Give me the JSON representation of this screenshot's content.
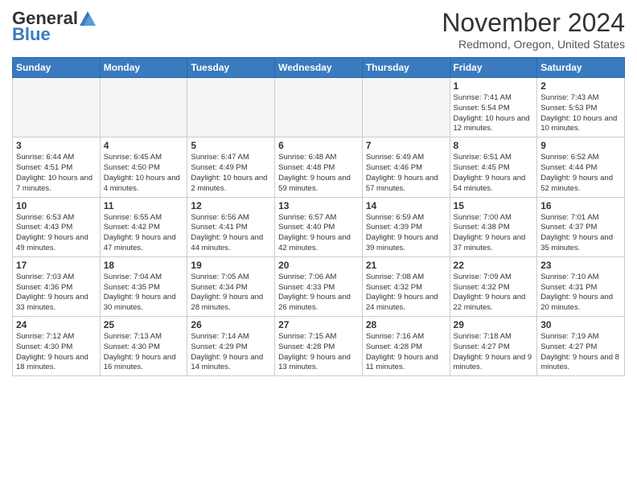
{
  "header": {
    "logo_general": "General",
    "logo_blue": "Blue",
    "month_title": "November 2024",
    "location": "Redmond, Oregon, United States"
  },
  "days_of_week": [
    "Sunday",
    "Monday",
    "Tuesday",
    "Wednesday",
    "Thursday",
    "Friday",
    "Saturday"
  ],
  "weeks": [
    [
      {
        "day": "",
        "info": ""
      },
      {
        "day": "",
        "info": ""
      },
      {
        "day": "",
        "info": ""
      },
      {
        "day": "",
        "info": ""
      },
      {
        "day": "",
        "info": ""
      },
      {
        "day": "1",
        "info": "Sunrise: 7:41 AM\nSunset: 5:54 PM\nDaylight: 10 hours and 12 minutes."
      },
      {
        "day": "2",
        "info": "Sunrise: 7:43 AM\nSunset: 5:53 PM\nDaylight: 10 hours and 10 minutes."
      }
    ],
    [
      {
        "day": "3",
        "info": "Sunrise: 6:44 AM\nSunset: 4:51 PM\nDaylight: 10 hours and 7 minutes."
      },
      {
        "day": "4",
        "info": "Sunrise: 6:45 AM\nSunset: 4:50 PM\nDaylight: 10 hours and 4 minutes."
      },
      {
        "day": "5",
        "info": "Sunrise: 6:47 AM\nSunset: 4:49 PM\nDaylight: 10 hours and 2 minutes."
      },
      {
        "day": "6",
        "info": "Sunrise: 6:48 AM\nSunset: 4:48 PM\nDaylight: 9 hours and 59 minutes."
      },
      {
        "day": "7",
        "info": "Sunrise: 6:49 AM\nSunset: 4:46 PM\nDaylight: 9 hours and 57 minutes."
      },
      {
        "day": "8",
        "info": "Sunrise: 6:51 AM\nSunset: 4:45 PM\nDaylight: 9 hours and 54 minutes."
      },
      {
        "day": "9",
        "info": "Sunrise: 6:52 AM\nSunset: 4:44 PM\nDaylight: 9 hours and 52 minutes."
      }
    ],
    [
      {
        "day": "10",
        "info": "Sunrise: 6:53 AM\nSunset: 4:43 PM\nDaylight: 9 hours and 49 minutes."
      },
      {
        "day": "11",
        "info": "Sunrise: 6:55 AM\nSunset: 4:42 PM\nDaylight: 9 hours and 47 minutes."
      },
      {
        "day": "12",
        "info": "Sunrise: 6:56 AM\nSunset: 4:41 PM\nDaylight: 9 hours and 44 minutes."
      },
      {
        "day": "13",
        "info": "Sunrise: 6:57 AM\nSunset: 4:40 PM\nDaylight: 9 hours and 42 minutes."
      },
      {
        "day": "14",
        "info": "Sunrise: 6:59 AM\nSunset: 4:39 PM\nDaylight: 9 hours and 39 minutes."
      },
      {
        "day": "15",
        "info": "Sunrise: 7:00 AM\nSunset: 4:38 PM\nDaylight: 9 hours and 37 minutes."
      },
      {
        "day": "16",
        "info": "Sunrise: 7:01 AM\nSunset: 4:37 PM\nDaylight: 9 hours and 35 minutes."
      }
    ],
    [
      {
        "day": "17",
        "info": "Sunrise: 7:03 AM\nSunset: 4:36 PM\nDaylight: 9 hours and 33 minutes."
      },
      {
        "day": "18",
        "info": "Sunrise: 7:04 AM\nSunset: 4:35 PM\nDaylight: 9 hours and 30 minutes."
      },
      {
        "day": "19",
        "info": "Sunrise: 7:05 AM\nSunset: 4:34 PM\nDaylight: 9 hours and 28 minutes."
      },
      {
        "day": "20",
        "info": "Sunrise: 7:06 AM\nSunset: 4:33 PM\nDaylight: 9 hours and 26 minutes."
      },
      {
        "day": "21",
        "info": "Sunrise: 7:08 AM\nSunset: 4:32 PM\nDaylight: 9 hours and 24 minutes."
      },
      {
        "day": "22",
        "info": "Sunrise: 7:09 AM\nSunset: 4:32 PM\nDaylight: 9 hours and 22 minutes."
      },
      {
        "day": "23",
        "info": "Sunrise: 7:10 AM\nSunset: 4:31 PM\nDaylight: 9 hours and 20 minutes."
      }
    ],
    [
      {
        "day": "24",
        "info": "Sunrise: 7:12 AM\nSunset: 4:30 PM\nDaylight: 9 hours and 18 minutes."
      },
      {
        "day": "25",
        "info": "Sunrise: 7:13 AM\nSunset: 4:30 PM\nDaylight: 9 hours and 16 minutes."
      },
      {
        "day": "26",
        "info": "Sunrise: 7:14 AM\nSunset: 4:29 PM\nDaylight: 9 hours and 14 minutes."
      },
      {
        "day": "27",
        "info": "Sunrise: 7:15 AM\nSunset: 4:28 PM\nDaylight: 9 hours and 13 minutes."
      },
      {
        "day": "28",
        "info": "Sunrise: 7:16 AM\nSunset: 4:28 PM\nDaylight: 9 hours and 11 minutes."
      },
      {
        "day": "29",
        "info": "Sunrise: 7:18 AM\nSunset: 4:27 PM\nDaylight: 9 hours and 9 minutes."
      },
      {
        "day": "30",
        "info": "Sunrise: 7:19 AM\nSunset: 4:27 PM\nDaylight: 9 hours and 8 minutes."
      }
    ]
  ]
}
